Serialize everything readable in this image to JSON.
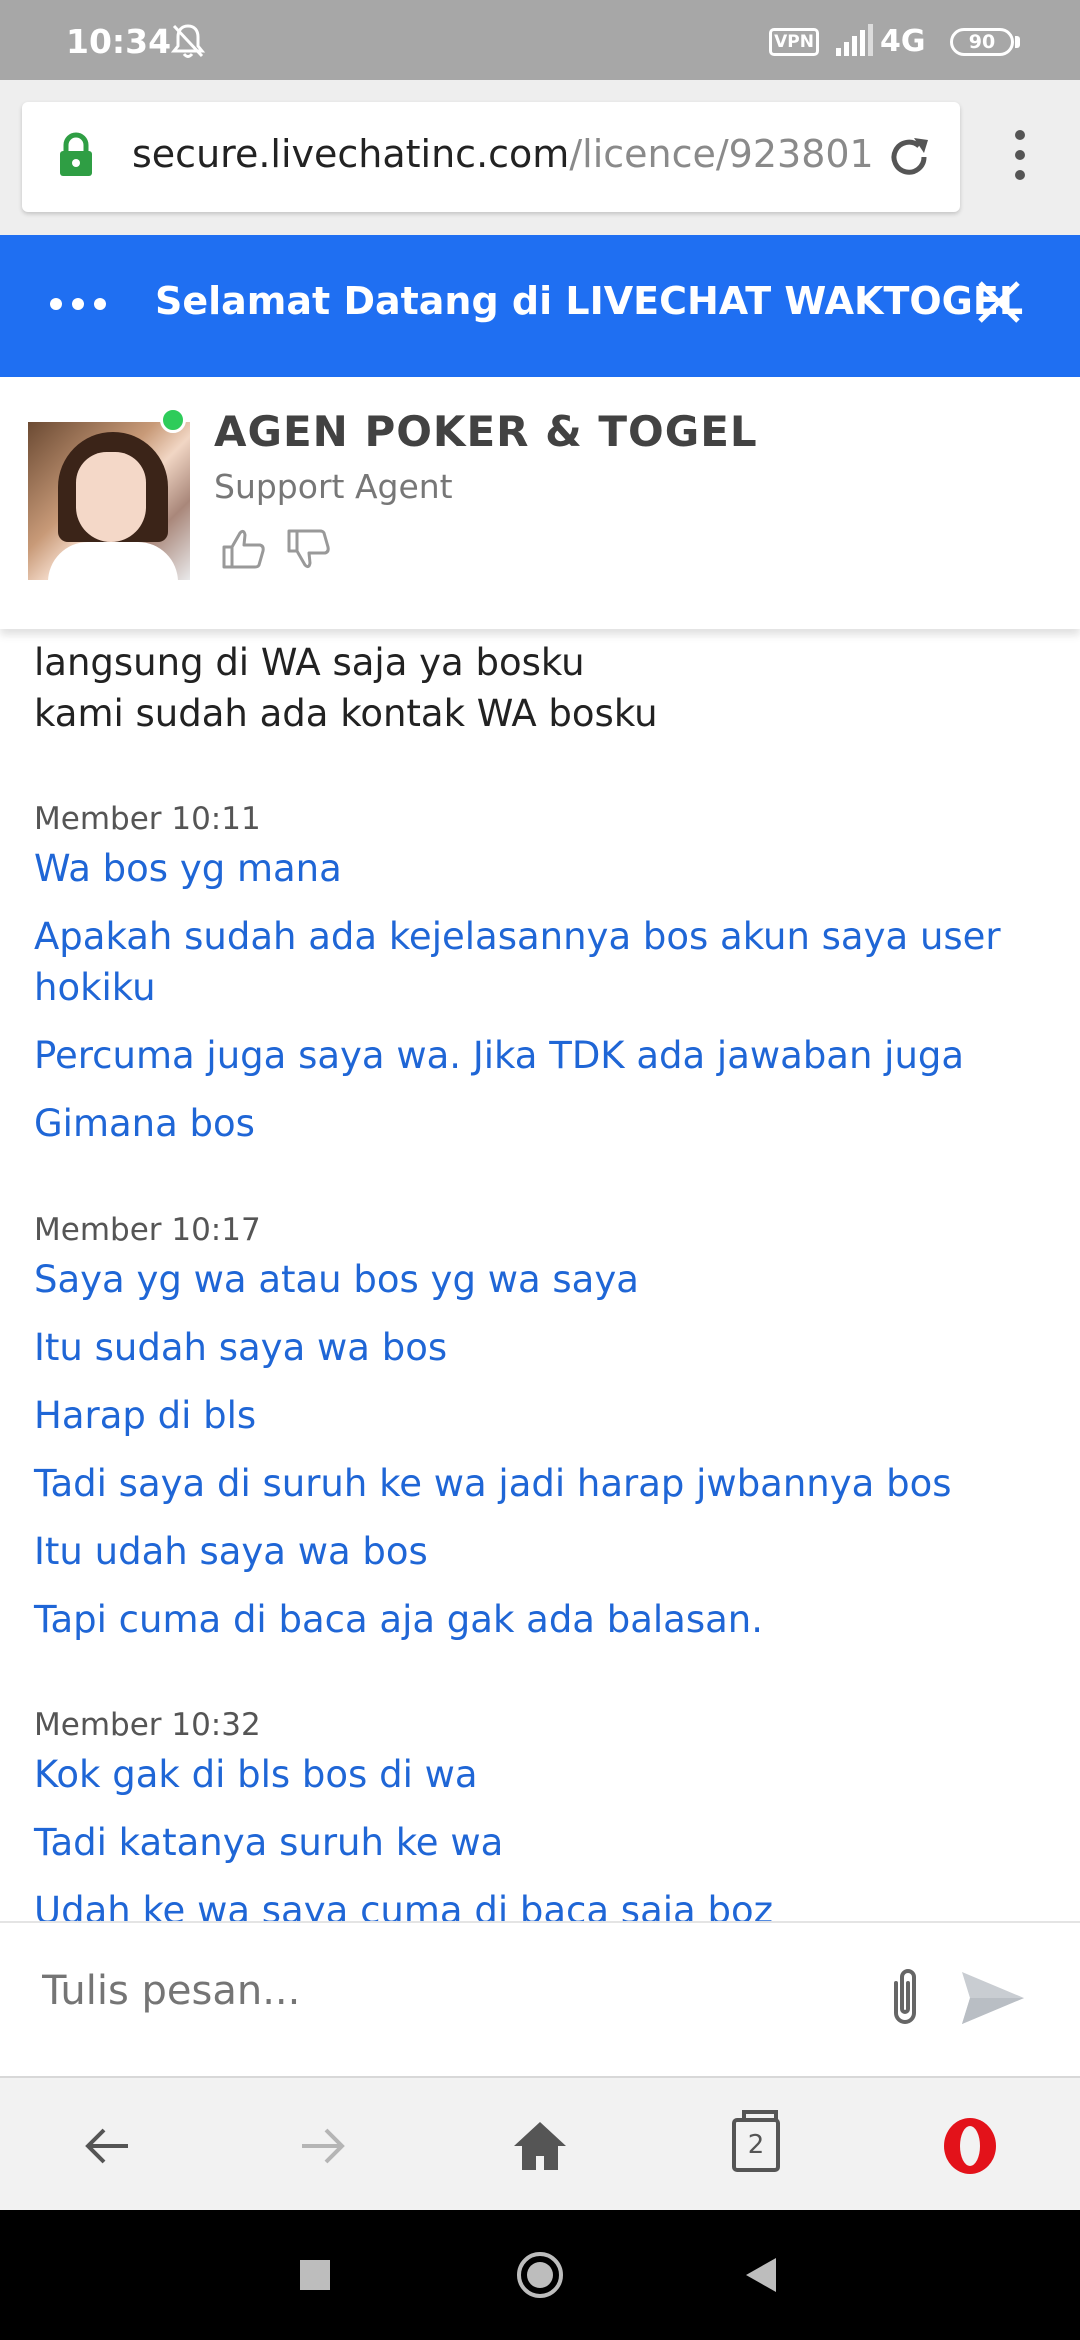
{
  "status_bar": {
    "time": "10:34",
    "vpn": "VPN",
    "network": "4G",
    "battery": "90",
    "icons": [
      "bell-muted-icon",
      "signal-icon"
    ]
  },
  "browser": {
    "url_host": "secure.livechatinc.com",
    "url_path": "/licence/923801",
    "icons": [
      "lock-icon",
      "reload-icon",
      "menu-icon"
    ]
  },
  "chat_header": {
    "title": "Selamat Datang di LIVECHAT WAKTOGEL"
  },
  "agent": {
    "name": "AGEN POKER & TOGEL",
    "role": "Support Agent",
    "status_color": "#2ecc5a"
  },
  "messages": {
    "agent_lines": [
      "langsung di WA saja ya bosku",
      "kami sudah ada kontak WA bosku"
    ],
    "groups": [
      {
        "meta": "Member 10:11",
        "lines": [
          "Wa bos yg mana",
          "Apakah sudah ada kejelasannya bos akun saya user hokiku",
          "Percuma juga saya wa. Jika TDK ada jawaban juga",
          "Gimana bos"
        ]
      },
      {
        "meta": "Member 10:17",
        "lines": [
          "Saya yg wa atau bos yg wa saya",
          "Itu sudah saya wa bos",
          "Harap di bls",
          "Tadi saya di suruh ke wa jadi harap jwbannya bos",
          "Itu udah saya wa bos",
          "Tapi cuma di baca aja gak ada balasan."
        ]
      },
      {
        "meta": "Member 10:32",
        "lines": [
          "Kok gak di bls bos di wa",
          "Tadi katanya suruh ke wa",
          "Udah ke wa saya cuma di baca saja boz"
        ]
      }
    ]
  },
  "composer": {
    "placeholder": "Tulis pesan..."
  },
  "bottom_nav": {
    "tab_count": "2"
  },
  "colors": {
    "accent": "#1f6ff2",
    "member_text": "#1f66d6"
  }
}
